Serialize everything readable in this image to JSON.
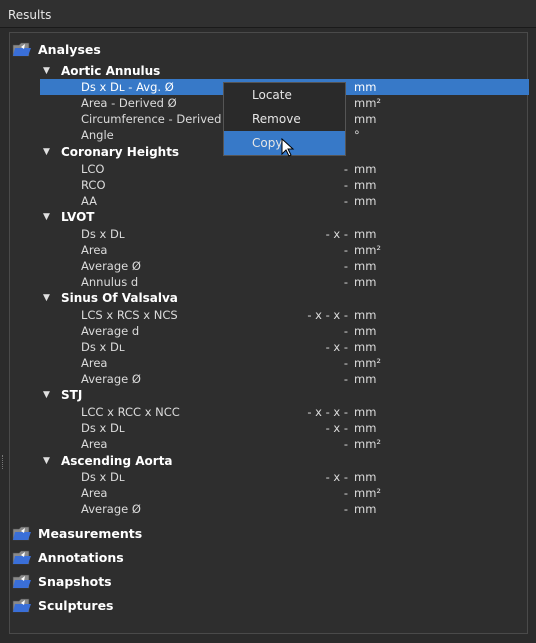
{
  "window": {
    "title": "Results"
  },
  "sections": [
    {
      "label": "Analyses"
    },
    {
      "label": "Measurements"
    },
    {
      "label": "Annotations"
    },
    {
      "label": "Snapshots"
    },
    {
      "label": "Sculptures"
    }
  ],
  "groups": [
    {
      "label": "Aortic Annulus",
      "rows": [
        {
          "label": "Ds x Dʟ - Avg. Ø",
          "value": "",
          "unit": "mm"
        },
        {
          "label": "Area - Derived Ø",
          "value": "",
          "unit": "mm²"
        },
        {
          "label": "Circumference - Derived",
          "value": "",
          "unit": "mm"
        },
        {
          "label": "Angle",
          "value": "",
          "unit": "°"
        }
      ]
    },
    {
      "label": "Coronary Heights",
      "rows": [
        {
          "label": "LCO",
          "value": "-",
          "unit": "mm"
        },
        {
          "label": "RCO",
          "value": "-",
          "unit": "mm"
        },
        {
          "label": "AA",
          "value": "-",
          "unit": "mm"
        }
      ]
    },
    {
      "label": "LVOT",
      "rows": [
        {
          "label": "Ds x Dʟ",
          "value": "- x -",
          "unit": "mm"
        },
        {
          "label": "Area",
          "value": "-",
          "unit": "mm²"
        },
        {
          "label": "Average Ø",
          "value": "-",
          "unit": "mm"
        },
        {
          "label": "Annulus d",
          "value": "-",
          "unit": "mm"
        }
      ]
    },
    {
      "label": "Sinus Of Valsalva",
      "rows": [
        {
          "label": "LCS x RCS x NCS",
          "value": "- x - x -",
          "unit": "mm"
        },
        {
          "label": "Average d",
          "value": "-",
          "unit": "mm"
        },
        {
          "label": "Ds x Dʟ",
          "value": "- x -",
          "unit": "mm"
        },
        {
          "label": "Area",
          "value": "-",
          "unit": "mm²"
        },
        {
          "label": "Average Ø",
          "value": "-",
          "unit": "mm"
        }
      ]
    },
    {
      "label": "STJ",
      "rows": [
        {
          "label": "LCC x RCC x NCC",
          "value": "- x - x -",
          "unit": "mm"
        },
        {
          "label": "Ds x Dʟ",
          "value": "- x -",
          "unit": "mm"
        },
        {
          "label": "Area",
          "value": "-",
          "unit": "mm²"
        }
      ]
    },
    {
      "label": "Ascending Aorta",
      "rows": [
        {
          "label": "Ds x Dʟ",
          "value": "- x -",
          "unit": "mm"
        },
        {
          "label": "Area",
          "value": "-",
          "unit": "mm²"
        },
        {
          "label": "Average Ø",
          "value": "-",
          "unit": "mm"
        }
      ]
    }
  ],
  "context_menu": {
    "items": [
      {
        "label": "Locate"
      },
      {
        "label": "Remove"
      },
      {
        "label": "Copy"
      }
    ],
    "hovered": "Copy"
  },
  "icons": {
    "folder": "folder-open-icon",
    "expand": "triangle-down-icon",
    "cursor": "mouse-pointer-icon"
  },
  "colors": {
    "selection": "#3779c8",
    "folder_blue": "#3a6fd8"
  }
}
